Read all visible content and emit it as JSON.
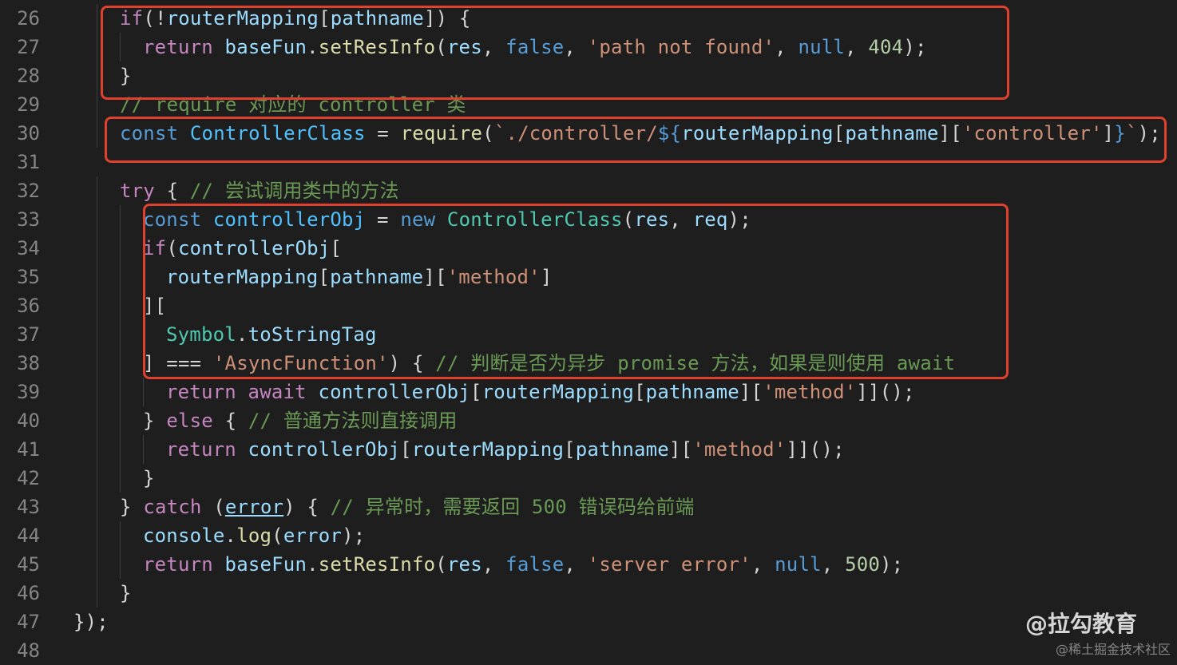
{
  "colors": {
    "background": "#1e1e1e",
    "line_number": "#858585",
    "keyword_control": "#c586c0",
    "keyword_storage": "#569cd6",
    "variable": "#9cdcfe",
    "constant": "#4fc1ff",
    "function": "#dcdcaa",
    "class": "#4ec9b0",
    "string": "#ce9178",
    "number": "#b5cea8",
    "comment": "#6a9955",
    "punctuation": "#d4d4d4",
    "highlight_box": "#e0412f"
  },
  "lines": [
    {
      "num": "26",
      "indent": 2,
      "tokens": [
        [
          "if",
          "kc"
        ],
        [
          "(!",
          "p"
        ],
        [
          "routerMapping",
          "v"
        ],
        [
          "[",
          "p"
        ],
        [
          "pathname",
          "v"
        ],
        [
          "]) {",
          "p"
        ]
      ]
    },
    {
      "num": "27",
      "indent": 3,
      "tokens": [
        [
          "return ",
          "kc"
        ],
        [
          "baseFun",
          "v"
        ],
        [
          ".",
          "p"
        ],
        [
          "setResInfo",
          "f"
        ],
        [
          "(",
          "p"
        ],
        [
          "res",
          "v"
        ],
        [
          ", ",
          "p"
        ],
        [
          "false",
          "ks"
        ],
        [
          ", ",
          "p"
        ],
        [
          "'path not found'",
          "s"
        ],
        [
          ", ",
          "p"
        ],
        [
          "null",
          "ks"
        ],
        [
          ", ",
          "p"
        ],
        [
          "404",
          "n"
        ],
        [
          ");",
          "p"
        ]
      ]
    },
    {
      "num": "28",
      "indent": 2,
      "tokens": [
        [
          "}",
          "p"
        ]
      ]
    },
    {
      "num": "29",
      "indent": 2,
      "tokens": [
        [
          "// require 对应的 controller 类",
          "c"
        ]
      ]
    },
    {
      "num": "30",
      "indent": 2,
      "tokens": [
        [
          "const ",
          "ks"
        ],
        [
          "ControllerClass",
          "k"
        ],
        [
          " = ",
          "p"
        ],
        [
          "require",
          "f"
        ],
        [
          "(",
          "p"
        ],
        [
          "`./controller/",
          "s"
        ],
        [
          "${",
          "ks"
        ],
        [
          "routerMapping",
          "v"
        ],
        [
          "[",
          "p"
        ],
        [
          "pathname",
          "v"
        ],
        [
          "][",
          "p"
        ],
        [
          "'controller'",
          "s"
        ],
        [
          "]",
          "p"
        ],
        [
          "}",
          "ks"
        ],
        [
          "`",
          "s"
        ],
        [
          ");",
          "p"
        ]
      ]
    },
    {
      "num": "31",
      "indent": 0,
      "tokens": []
    },
    {
      "num": "32",
      "indent": 2,
      "tokens": [
        [
          "try",
          "kc"
        ],
        [
          " { ",
          "p"
        ],
        [
          "// 尝试调用类中的方法",
          "c"
        ]
      ]
    },
    {
      "num": "33",
      "indent": 3,
      "tokens": [
        [
          "const ",
          "ks"
        ],
        [
          "controllerObj",
          "k"
        ],
        [
          " = ",
          "p"
        ],
        [
          "new ",
          "ks"
        ],
        [
          "ControllerClass",
          "cl"
        ],
        [
          "(",
          "p"
        ],
        [
          "res",
          "v"
        ],
        [
          ", ",
          "p"
        ],
        [
          "req",
          "v"
        ],
        [
          ");",
          "p"
        ]
      ]
    },
    {
      "num": "34",
      "indent": 3,
      "tokens": [
        [
          "if",
          "kc"
        ],
        [
          "(",
          "p"
        ],
        [
          "controllerObj",
          "v"
        ],
        [
          "[",
          "p"
        ]
      ]
    },
    {
      "num": "35",
      "indent": 4,
      "tokens": [
        [
          "routerMapping",
          "v"
        ],
        [
          "[",
          "p"
        ],
        [
          "pathname",
          "v"
        ],
        [
          "][",
          "p"
        ],
        [
          "'method'",
          "s"
        ],
        [
          "]",
          "p"
        ]
      ]
    },
    {
      "num": "36",
      "indent": 3,
      "tokens": [
        [
          "][",
          "p"
        ]
      ]
    },
    {
      "num": "37",
      "indent": 4,
      "tokens": [
        [
          "Symbol",
          "cl"
        ],
        [
          ".",
          "p"
        ],
        [
          "toStringTag",
          "v"
        ]
      ]
    },
    {
      "num": "38",
      "indent": 3,
      "tokens": [
        [
          "] === ",
          "p"
        ],
        [
          "'AsyncFunction'",
          "s"
        ],
        [
          ") { ",
          "p"
        ],
        [
          "// 判断是否为异步 promise 方法，如果是则使用 await",
          "c"
        ]
      ]
    },
    {
      "num": "39",
      "indent": 4,
      "tokens": [
        [
          "return ",
          "kc"
        ],
        [
          "await ",
          "kc"
        ],
        [
          "controllerObj",
          "v"
        ],
        [
          "[",
          "p"
        ],
        [
          "routerMapping",
          "v"
        ],
        [
          "[",
          "p"
        ],
        [
          "pathname",
          "v"
        ],
        [
          "][",
          "p"
        ],
        [
          "'method'",
          "s"
        ],
        [
          "]]();",
          "p"
        ]
      ]
    },
    {
      "num": "40",
      "indent": 3,
      "tokens": [
        [
          "} ",
          "p"
        ],
        [
          "else",
          "kc"
        ],
        [
          " { ",
          "p"
        ],
        [
          "// 普通方法则直接调用",
          "c"
        ]
      ]
    },
    {
      "num": "41",
      "indent": 4,
      "tokens": [
        [
          "return ",
          "kc"
        ],
        [
          "controllerObj",
          "v"
        ],
        [
          "[",
          "p"
        ],
        [
          "routerMapping",
          "v"
        ],
        [
          "[",
          "p"
        ],
        [
          "pathname",
          "v"
        ],
        [
          "][",
          "p"
        ],
        [
          "'method'",
          "s"
        ],
        [
          "]]();",
          "p"
        ]
      ]
    },
    {
      "num": "42",
      "indent": 3,
      "tokens": [
        [
          "}",
          "p"
        ]
      ]
    },
    {
      "num": "43",
      "indent": 2,
      "tokens": [
        [
          "} ",
          "p"
        ],
        [
          "catch",
          "kc"
        ],
        [
          " (",
          "p"
        ],
        [
          "error",
          "v"
        ],
        [
          ") { ",
          "p"
        ],
        [
          "// 异常时，需要返回 500 错误码给前端",
          "c"
        ]
      ]
    },
    {
      "num": "44",
      "indent": 3,
      "tokens": [
        [
          "console",
          "v"
        ],
        [
          ".",
          "p"
        ],
        [
          "log",
          "f"
        ],
        [
          "(",
          "p"
        ],
        [
          "error",
          "v"
        ],
        [
          ");",
          "p"
        ]
      ]
    },
    {
      "num": "45",
      "indent": 3,
      "tokens": [
        [
          "return ",
          "kc"
        ],
        [
          "baseFun",
          "v"
        ],
        [
          ".",
          "p"
        ],
        [
          "setResInfo",
          "f"
        ],
        [
          "(",
          "p"
        ],
        [
          "res",
          "v"
        ],
        [
          ", ",
          "p"
        ],
        [
          "false",
          "ks"
        ],
        [
          ", ",
          "p"
        ],
        [
          "'server error'",
          "s"
        ],
        [
          ", ",
          "p"
        ],
        [
          "null",
          "ks"
        ],
        [
          ", ",
          "p"
        ],
        [
          "500",
          "n"
        ],
        [
          ");",
          "p"
        ]
      ]
    },
    {
      "num": "46",
      "indent": 2,
      "tokens": [
        [
          "}",
          "p"
        ]
      ]
    },
    {
      "num": "47",
      "indent": 0,
      "tokens": [
        [
          "});",
          "p"
        ]
      ]
    },
    {
      "num": "48",
      "indent": 0,
      "tokens": []
    }
  ],
  "watermark": {
    "brand": "@拉勾教育",
    "site": "@稀土掘金技术社区"
  }
}
